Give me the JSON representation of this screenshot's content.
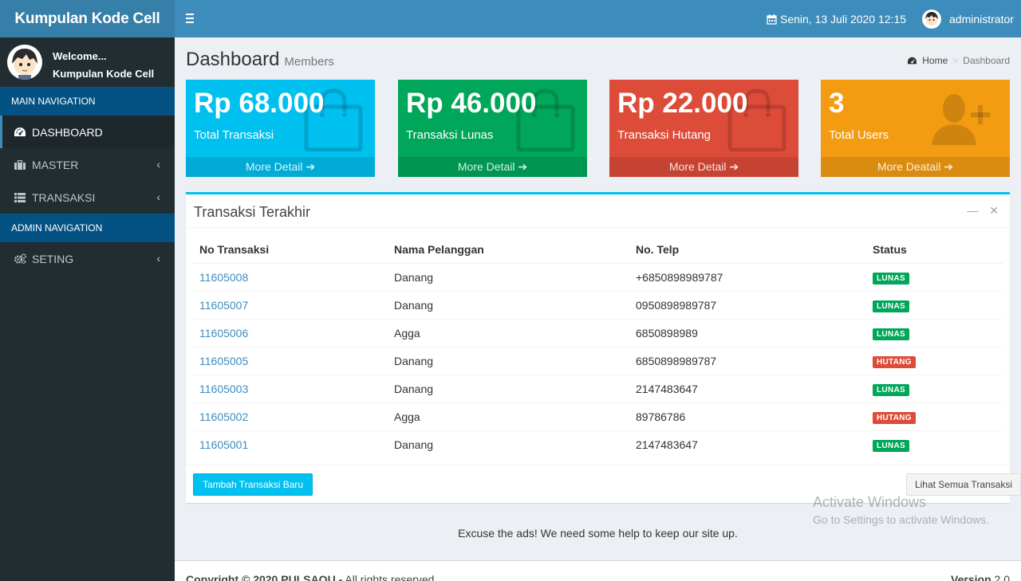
{
  "app": {
    "title": "Kumpulan Kode Cell"
  },
  "topbar": {
    "date": "Senin, 13 Juli 2020 12:15",
    "user": "administrator"
  },
  "sidebar": {
    "welcome": "Welcome...",
    "username": "Kumpulan Kode Cell",
    "main_header": "MAIN NAVIGATION",
    "admin_header": "ADMIN NAVIGATION",
    "items": [
      {
        "label": "DASHBOARD",
        "icon": "dashboard-icon"
      },
      {
        "label": "MASTER",
        "icon": "briefcase-icon"
      },
      {
        "label": "TRANSAKSI",
        "icon": "list-icon"
      },
      {
        "label": "SETING",
        "icon": "gears-icon"
      }
    ]
  },
  "page": {
    "title": "Dashboard",
    "subtitle": "Members"
  },
  "breadcrumb": {
    "home": "Home",
    "current": "Dashboard"
  },
  "stats": [
    {
      "value": "Rp 68.000",
      "label": "Total Transaksi",
      "link": "More Detail",
      "color": "#00c0ef",
      "icon": "shopping-bag-icon"
    },
    {
      "value": "Rp 46.000",
      "label": "Transaksi Lunas",
      "link": "More Detail",
      "color": "#00a65a",
      "icon": "shopping-bag-icon"
    },
    {
      "value": "Rp 22.000",
      "label": "Transaksi Hutang",
      "link": "More Detail",
      "color": "#dd4b39",
      "icon": "shopping-bag-icon"
    },
    {
      "value": "3",
      "label": "Total Users",
      "link": "More Deatail",
      "color": "#f39c12",
      "icon": "user-add-icon"
    }
  ],
  "recent": {
    "title": "Transaksi Terakhir",
    "columns": [
      "No Transaksi",
      "Nama Pelanggan",
      "No. Telp",
      "Status"
    ],
    "rows": [
      {
        "no": "11605008",
        "nama": "Danang",
        "telp": "+6850898989787",
        "status": "LUNAS"
      },
      {
        "no": "11605007",
        "nama": "Danang",
        "telp": "0950898989787",
        "status": "LUNAS"
      },
      {
        "no": "11605006",
        "nama": "Agga",
        "telp": "6850898989",
        "status": "LUNAS"
      },
      {
        "no": "11605005",
        "nama": "Danang",
        "telp": "6850898989787",
        "status": "HUTANG"
      },
      {
        "no": "11605003",
        "nama": "Danang",
        "telp": "2147483647",
        "status": "LUNAS"
      },
      {
        "no": "11605002",
        "nama": "Agga",
        "telp": "89786786",
        "status": "HUTANG"
      },
      {
        "no": "11605001",
        "nama": "Danang",
        "telp": "2147483647",
        "status": "LUNAS"
      }
    ],
    "status_colors": {
      "LUNAS": "#00a65a",
      "HUTANG": "#dd4b39"
    },
    "btn_new": "Tambah Transaksi Baru",
    "btn_all": "Lihat Semua Transaksi"
  },
  "ads": "Excuse the ads! We need some help to keep our site up.",
  "watermark": {
    "line1": "Activate Windows",
    "line2": "Go to Settings to activate Windows."
  },
  "footer": {
    "copy_bold": "Copyright © 2020 PULSAQU -",
    "copy_rest": " All rights reserved.",
    "version_label": "Version",
    "version": "2.0"
  }
}
